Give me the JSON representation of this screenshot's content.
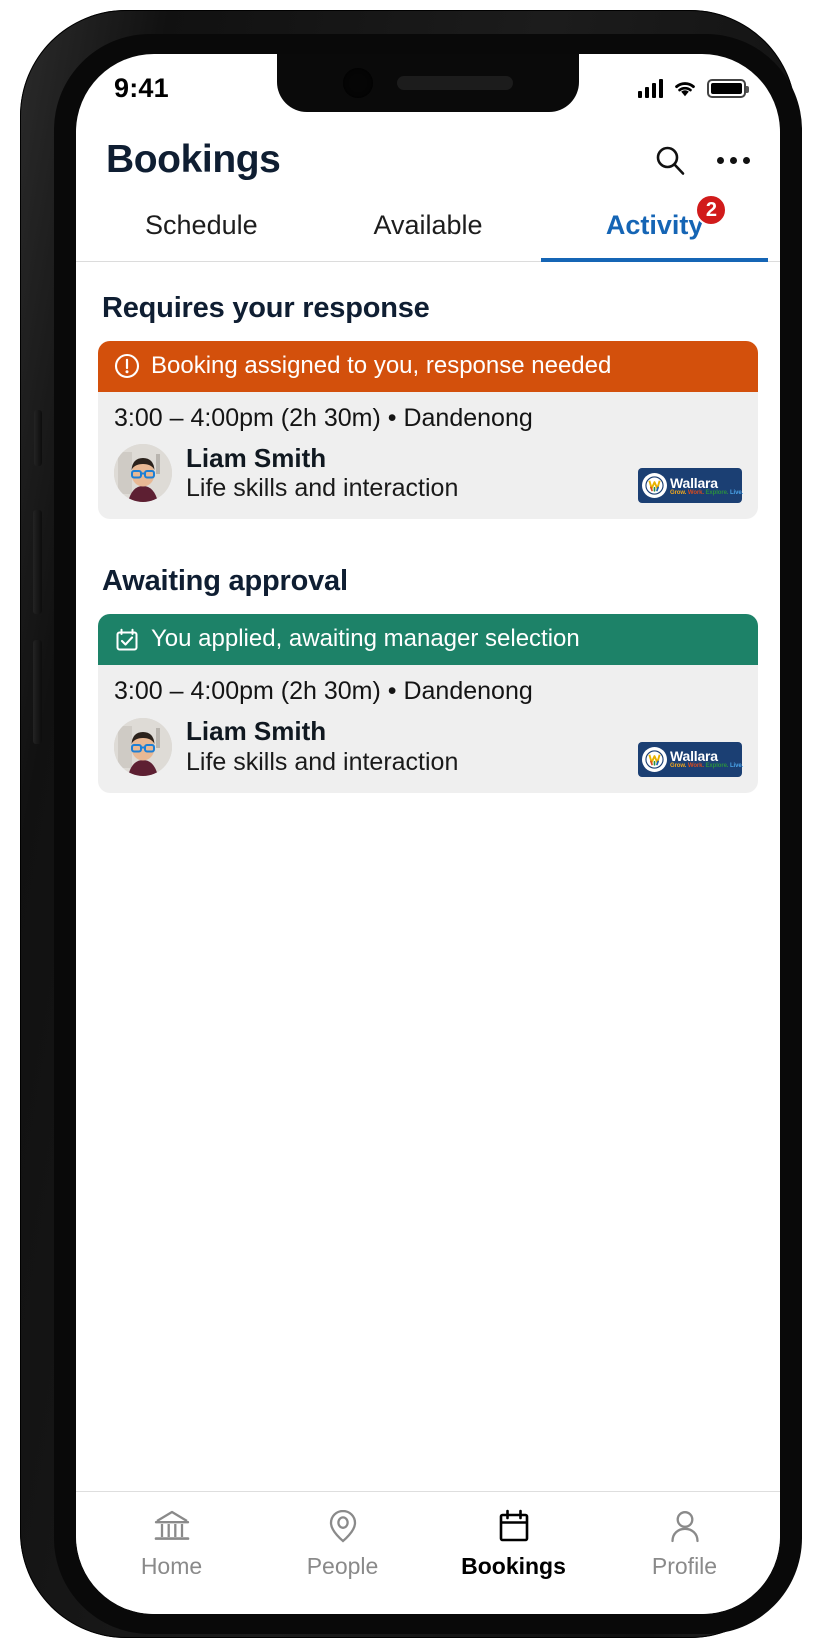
{
  "status_bar": {
    "time": "9:41",
    "signal_icon": "cellular-signal-icon",
    "wifi_icon": "wifi-icon",
    "battery_icon": "battery-full-icon"
  },
  "header": {
    "title": "Bookings",
    "search_icon": "search-icon",
    "more_icon": "more-options-icon"
  },
  "tabs": [
    {
      "label": "Schedule",
      "active": false,
      "badge": null
    },
    {
      "label": "Available",
      "active": false,
      "badge": null
    },
    {
      "label": "Activity",
      "active": true,
      "badge": "2"
    }
  ],
  "sections": [
    {
      "title": "Requires your response",
      "card": {
        "banner_text": "Booking assigned to you, response needed",
        "banner_icon": "alert-circle-icon",
        "banner_color": "#d3500c",
        "time_range": "3:00 – 4:00pm (2h 30m) • Dandenong",
        "person_name": "Liam Smith",
        "person_role": "Life skills and interaction",
        "org_name": "Wallara",
        "org_tagline": "Grow. Work. Explore. Live."
      }
    },
    {
      "title": "Awaiting approval",
      "card": {
        "banner_text": "You applied, awaiting manager selection",
        "banner_icon": "calendar-check-icon",
        "banner_color": "#1d8268",
        "time_range": "3:00 – 4:00pm (2h 30m) • Dandenong",
        "person_name": "Liam Smith",
        "person_role": "Life skills and interaction",
        "org_name": "Wallara",
        "org_tagline": "Grow. Work. Explore. Live."
      }
    }
  ],
  "bottom_nav": [
    {
      "label": "Home",
      "icon": "bank-icon",
      "active": false
    },
    {
      "label": "People",
      "icon": "location-pin-icon",
      "active": false
    },
    {
      "label": "Bookings",
      "icon": "calendar-icon",
      "active": true
    },
    {
      "label": "Profile",
      "icon": "person-icon",
      "active": false
    }
  ],
  "colors": {
    "accent_blue": "#1565b5",
    "badge_red": "#d11b1b",
    "alert_orange": "#d3500c",
    "success_green": "#1d8268",
    "title_navy": "#0f1e32"
  }
}
